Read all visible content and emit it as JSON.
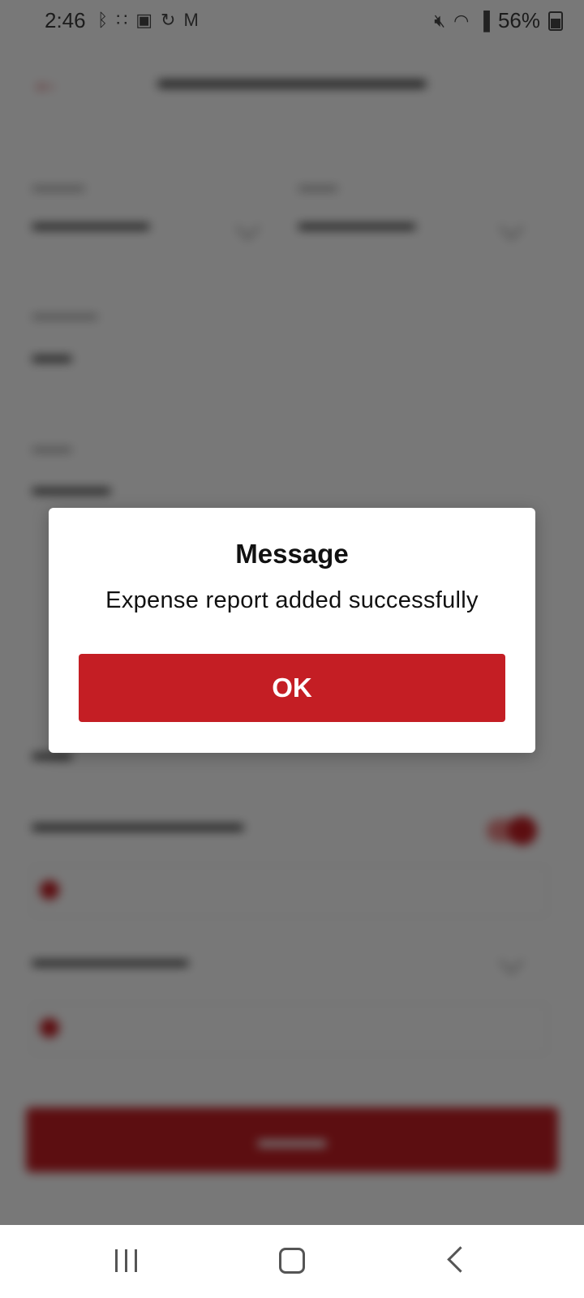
{
  "status_bar": {
    "time": "2:46",
    "battery": "56%",
    "left_icons": [
      "bluetooth-icon",
      "apps-icon",
      "teams-icon",
      "sync-icon",
      "gmail-icon"
    ],
    "right_icons": [
      "mute-icon",
      "wifi-icon",
      "signal-icon",
      "battery-icon"
    ]
  },
  "dialog": {
    "title": "Message",
    "message": "Expense report added successfully",
    "ok_label": "OK"
  },
  "colors": {
    "accent": "#c41e24",
    "scrim": "rgba(0,0,0,0.53)"
  },
  "nav_bar": {
    "icons": [
      "recents-icon",
      "home-icon",
      "back-icon"
    ]
  }
}
